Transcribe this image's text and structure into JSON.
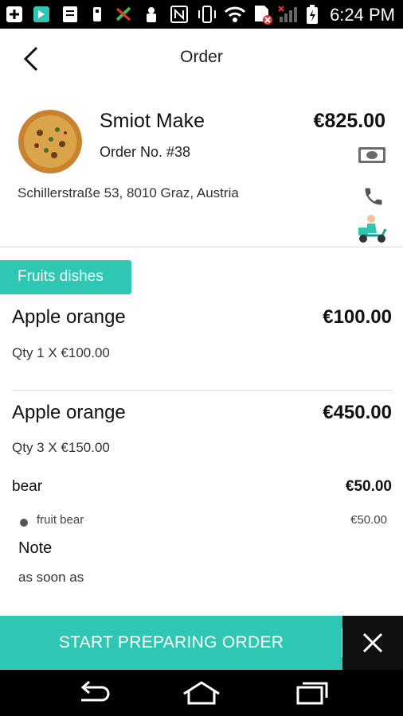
{
  "status_bar": {
    "time": "6:24 PM",
    "icons": [
      "add-box-icon",
      "shield-app-icon",
      "document-icon",
      "usb-icon",
      "battery-saver-off-icon",
      "lock-icon",
      "nfc-icon",
      "vibrate-icon",
      "wifi-icon",
      "sd-card-error-icon",
      "no-signal-icon",
      "battery-charging-icon"
    ]
  },
  "header": {
    "title": "Order"
  },
  "order": {
    "customer_name": "Smiot Make",
    "order_number": "Order No. #38",
    "total": "€825.00",
    "address": "Schillerstraße 53, 8010 Graz, Austria",
    "payment_icon": "cash-icon",
    "delivery_icon": "scooter-delivery-icon"
  },
  "category": {
    "label": "Fruits dishes"
  },
  "items": [
    {
      "name": "Apple orange",
      "price": "€100.00",
      "qty": "Qty 1 X €100.00"
    },
    {
      "name": "Apple orange",
      "price": "€450.00",
      "qty": "Qty 3 X €150.00"
    }
  ],
  "addon": {
    "name": "bear",
    "price": "€50.00",
    "sub_name": "fruit bear",
    "sub_price": "€50.00"
  },
  "note": {
    "label": "Note",
    "text": "as soon as"
  },
  "actions": {
    "start_label": "START PREPARING ORDER"
  },
  "colors": {
    "accent": "#2ec7b4",
    "dark": "#111111"
  }
}
